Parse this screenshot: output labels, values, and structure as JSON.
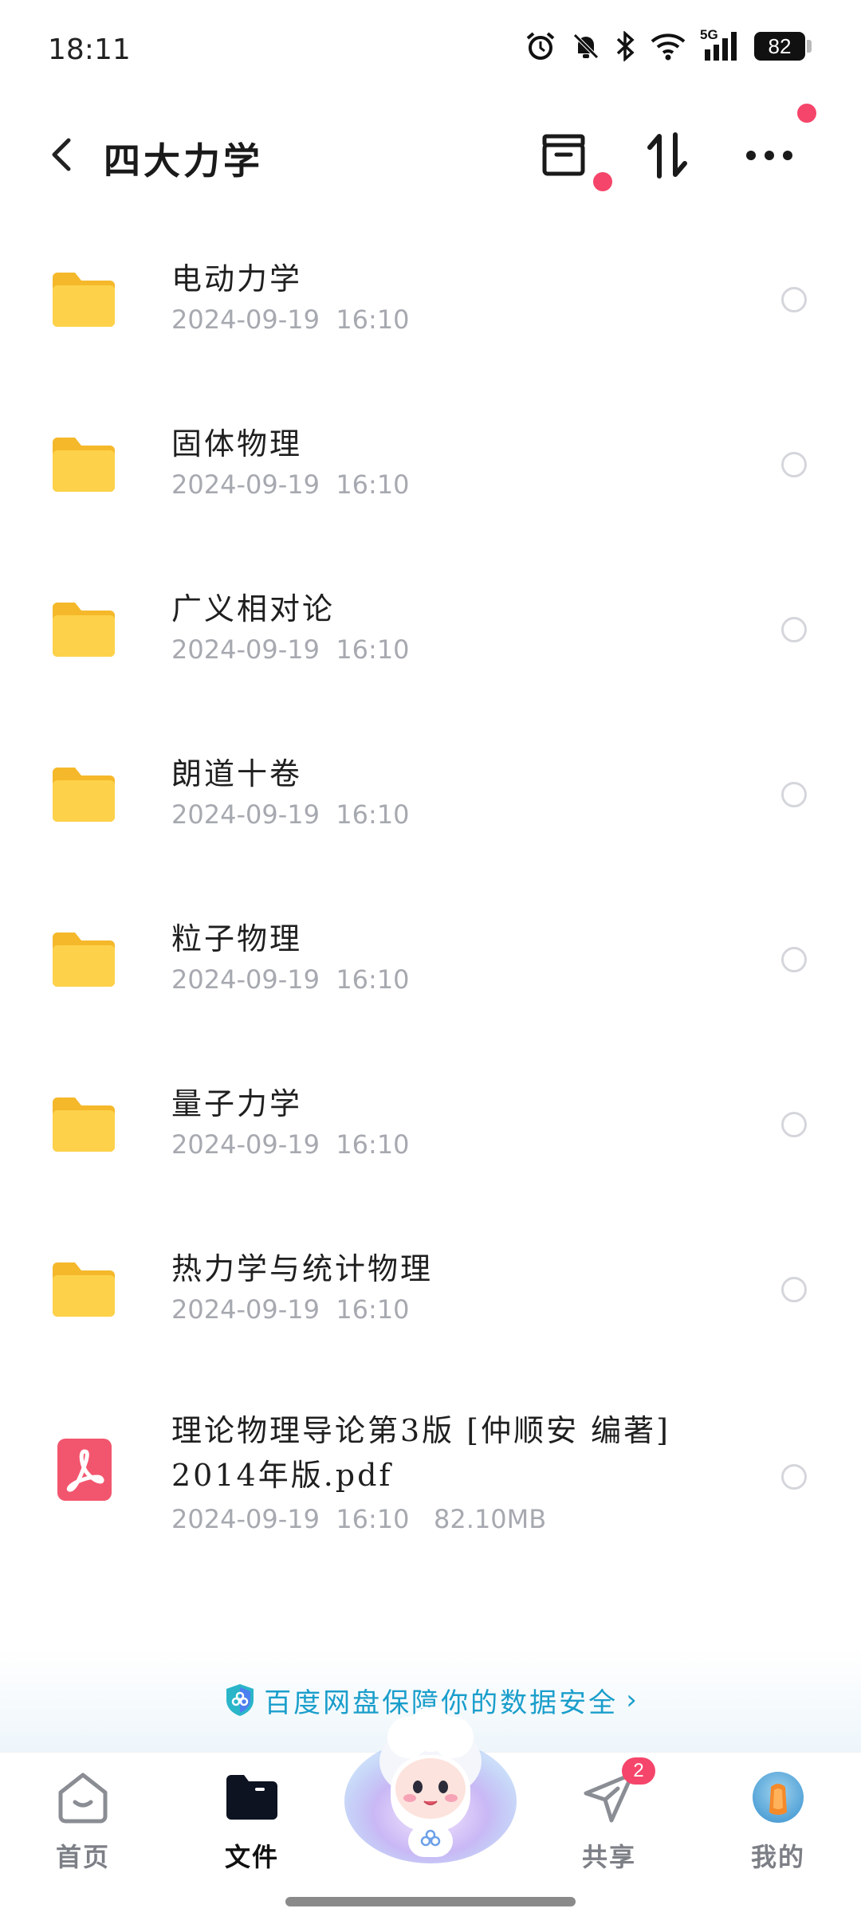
{
  "status_bar": {
    "time": "18:11",
    "network": "5G",
    "battery": "82"
  },
  "header": {
    "title": "四大力学"
  },
  "files": [
    {
      "name": "电动力学",
      "meta": "2024-09-19  16:10",
      "type": "folder"
    },
    {
      "name": "固体物理",
      "meta": "2024-09-19  16:10",
      "type": "folder"
    },
    {
      "name": "广义相对论",
      "meta": "2024-09-19  16:10",
      "type": "folder"
    },
    {
      "name": "朗道十卷",
      "meta": "2024-09-19  16:10",
      "type": "folder"
    },
    {
      "name": "粒子物理",
      "meta": "2024-09-19  16:10",
      "type": "folder"
    },
    {
      "name": "量子力学",
      "meta": "2024-09-19  16:10",
      "type": "folder"
    },
    {
      "name": "热力学与统计物理",
      "meta": "2024-09-19  16:10",
      "type": "folder"
    },
    {
      "name": "理论物理导论第3版 [仲顺安 编著] 2014年版.pdf",
      "meta": "2024-09-19  16:10   82.10MB",
      "type": "pdf"
    }
  ],
  "banner": {
    "text": "百度网盘保障你的数据安全",
    "chevron": "›"
  },
  "nav": {
    "home": "首页",
    "files": "文件",
    "share": "共享",
    "share_badge": "2",
    "mine": "我的"
  },
  "colors": {
    "accent": "#1a9ecb",
    "folder": "#fcc93a",
    "pdf": "#f2566e",
    "badge": "#f5456a"
  }
}
